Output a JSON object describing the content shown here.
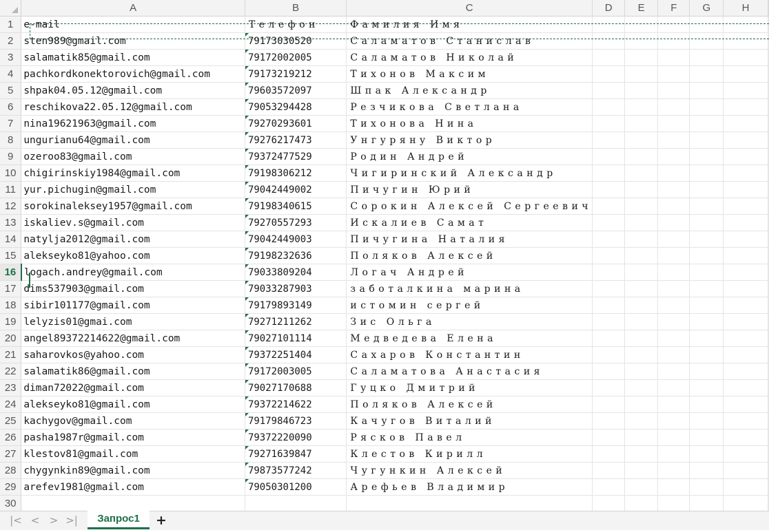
{
  "columns": [
    "A",
    "B",
    "C",
    "D",
    "E",
    "F",
    "G",
    "H"
  ],
  "header_row": {
    "row": "1",
    "email": "e-mail",
    "phone": "Телефон",
    "name": "Фамилия Имя"
  },
  "rows": [
    {
      "row": "2",
      "email": "sten989@gmail.com",
      "phone": "79173030520",
      "name": "Саламатов Станислав"
    },
    {
      "row": "3",
      "email": "salamatik85@gmail.com",
      "phone": "79172002005",
      "name": "Саламатов Николай"
    },
    {
      "row": "4",
      "email": "pachkordkonektorovich@gmail.com",
      "phone": "79173219212",
      "name": "Тихонов Максим"
    },
    {
      "row": "5",
      "email": "shpak04.05.12@gmail.com",
      "phone": "79603572097",
      "name": "Шпак Александр"
    },
    {
      "row": "6",
      "email": "reschikova22.05.12@gmail.com",
      "phone": "79053294428",
      "name": "Резчикова Светлана"
    },
    {
      "row": "7",
      "email": "nina19621963@gmail.com",
      "phone": "79270293601",
      "name": "Тихонова Нина"
    },
    {
      "row": "8",
      "email": "ungurianu64@gmail.com",
      "phone": "79276217473",
      "name": "Унгуряну Виктор"
    },
    {
      "row": "9",
      "email": "ozeroo83@gmail.com",
      "phone": "79372477529",
      "name": "Родин Андрей"
    },
    {
      "row": "10",
      "email": "chigirinskiy1984@gmail.com",
      "phone": "79198306212",
      "name": "Чигиринский Александр"
    },
    {
      "row": "11",
      "email": "yur.pichugin@gmail.com",
      "phone": "79042449002",
      "name": "Пичугин Юрий"
    },
    {
      "row": "12",
      "email": "sorokinaleksey1957@gmail.com",
      "phone": "79198340615",
      "name": "Сорокин Алексей Сергеевич"
    },
    {
      "row": "13",
      "email": "iskaliev.s@gmail.com",
      "phone": "79270557293",
      "name": "Искалиев Самат"
    },
    {
      "row": "14",
      "email": "natylja2012@gmail.com",
      "phone": "79042449003",
      "name": "Пичугина Наталия"
    },
    {
      "row": "15",
      "email": "alekseyko81@yahoo.com",
      "phone": "79198232636",
      "name": "Поляков Алексей"
    },
    {
      "row": "16",
      "email": "logach.andrey@gmail.com",
      "phone": "79033809204",
      "name": "Логач Андрей"
    },
    {
      "row": "17",
      "email": "dims537903@gmail.com",
      "phone": "79033287903",
      "name": "заботалкина марина"
    },
    {
      "row": "18",
      "email": "sibir101177@gmail.com",
      "phone": "79179893149",
      "name": "истомин сергей"
    },
    {
      "row": "19",
      "email": "lelyzis01@gmai.com",
      "phone": "79271211262",
      "name": "Зис Ольга"
    },
    {
      "row": "20",
      "email": "angel89372214622@gmail.com",
      "phone": "79027101114",
      "name": "Медведева Елена"
    },
    {
      "row": "21",
      "email": "saharovkos@yahoo.com",
      "phone": "79372251404",
      "name": "Сахаров Константин"
    },
    {
      "row": "22",
      "email": "salamatik86@gmail.com",
      "phone": "79172003005",
      "name": "Саламатова Анастасия"
    },
    {
      "row": "23",
      "email": "diman72022@gmail.com",
      "phone": "79027170688",
      "name": "Гуцко Дмитрий"
    },
    {
      "row": "24",
      "email": "alekseyko81@gmail.com",
      "phone": "79372214622",
      "name": "Поляков Алексей"
    },
    {
      "row": "25",
      "email": "kachygov@gmail.com",
      "phone": "79179846723",
      "name": "Качугов Виталий"
    },
    {
      "row": "26",
      "email": "pasha1987r@gmail.com",
      "phone": "79372220090",
      "name": "Рясков Павел"
    },
    {
      "row": "27",
      "email": "klestov81@gmail.com",
      "phone": "79271639847",
      "name": "Клестов Кирилл"
    },
    {
      "row": "28",
      "email": "chygynkin89@gmail.com",
      "phone": "79873577242",
      "name": "Чугункин Алексей"
    },
    {
      "row": "29",
      "email": "arefev1981@gmail.com",
      "phone": "79050301200",
      "name": "Арефьев Владимир"
    },
    {
      "row": "30",
      "email": "",
      "phone": "",
      "name": ""
    }
  ],
  "active_row": "16",
  "sheet_tabs": [
    {
      "label": "Запрос1",
      "active": true
    }
  ],
  "tab_add_label": "+",
  "nav_buttons": [
    "|<",
    "<",
    ">",
    ">|"
  ],
  "colors": {
    "accent": "#1e7145",
    "header_bg": "#f3f3f3",
    "grid": "#e4e4e4"
  }
}
